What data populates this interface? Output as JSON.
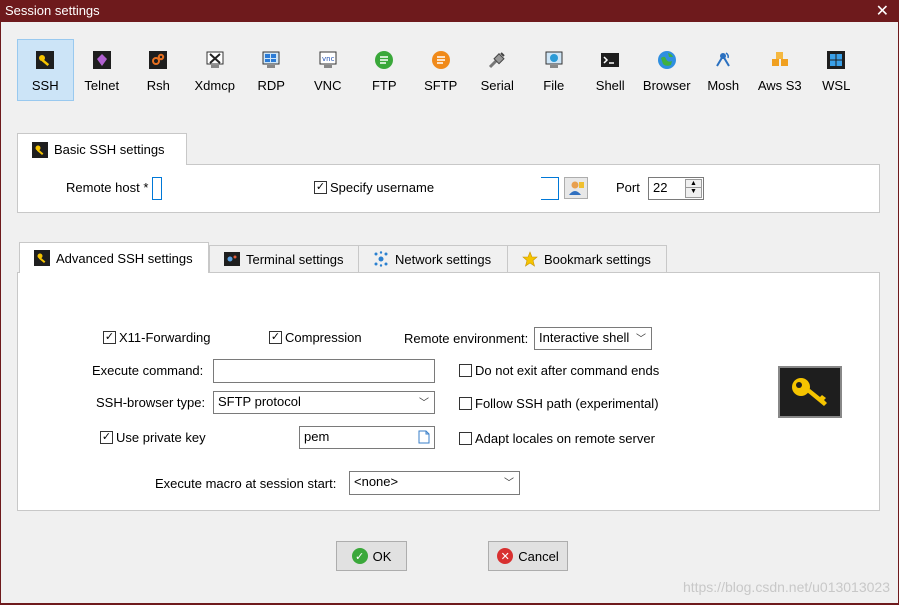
{
  "window": {
    "title": "Session settings"
  },
  "protocols": [
    {
      "label": "SSH",
      "icon": "ssh-key-icon",
      "active": true
    },
    {
      "label": "Telnet",
      "icon": "telnet-icon"
    },
    {
      "label": "Rsh",
      "icon": "rsh-icon"
    },
    {
      "label": "Xdmcp",
      "icon": "xdmcp-icon"
    },
    {
      "label": "RDP",
      "icon": "rdp-icon"
    },
    {
      "label": "VNC",
      "icon": "vnc-icon"
    },
    {
      "label": "FTP",
      "icon": "ftp-icon"
    },
    {
      "label": "SFTP",
      "icon": "sftp-icon"
    },
    {
      "label": "Serial",
      "icon": "serial-icon"
    },
    {
      "label": "File",
      "icon": "file-icon"
    },
    {
      "label": "Shell",
      "icon": "shell-icon"
    },
    {
      "label": "Browser",
      "icon": "browser-icon"
    },
    {
      "label": "Mosh",
      "icon": "mosh-icon"
    },
    {
      "label": "Aws S3",
      "icon": "aws-s3-icon"
    },
    {
      "label": "WSL",
      "icon": "wsl-icon"
    }
  ],
  "basic": {
    "tab_label": "Basic SSH settings",
    "remote_host_label": "Remote host *",
    "remote_host_value": "",
    "specify_username_label": "Specify username",
    "specify_username_checked": true,
    "username_value": "",
    "port_label": "Port",
    "port_value": "22"
  },
  "tabs": {
    "advanced": "Advanced SSH settings",
    "terminal": "Terminal settings",
    "network": "Network settings",
    "bookmark": "Bookmark settings"
  },
  "advanced": {
    "x11_label": "X11-Forwarding",
    "x11_checked": true,
    "compression_label": "Compression",
    "compression_checked": true,
    "remote_env_label": "Remote environment:",
    "remote_env_value": "Interactive shell",
    "exec_cmd_label": "Execute command:",
    "exec_cmd_value": "",
    "no_exit_label": "Do not exit after command ends",
    "no_exit_checked": false,
    "browser_type_label": "SSH-browser type:",
    "browser_type_value": "SFTP protocol",
    "follow_path_label": "Follow SSH path (experimental)",
    "follow_path_checked": false,
    "private_key_label": "Use private key",
    "private_key_checked": true,
    "private_key_value": "pem",
    "adapt_locales_label": "Adapt locales on remote server",
    "adapt_locales_checked": false,
    "macro_label": "Execute macro at session start:",
    "macro_value": "<none>"
  },
  "buttons": {
    "ok": "OK",
    "cancel": "Cancel"
  },
  "watermark": "https://blog.csdn.net/u013013023"
}
